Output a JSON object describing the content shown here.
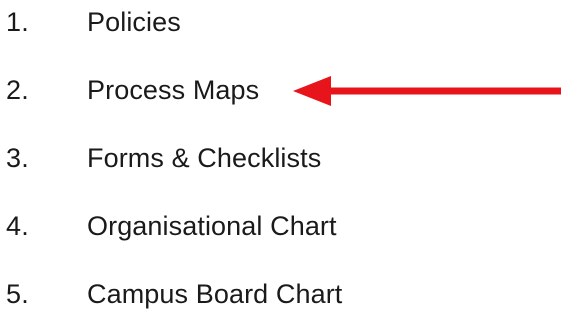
{
  "list": {
    "items": [
      {
        "number": "1.",
        "label": "Policies"
      },
      {
        "number": "2.",
        "label": "Process Maps"
      },
      {
        "number": "3.",
        "label": "Forms & Checklists"
      },
      {
        "number": "4.",
        "label": "Organisational Chart"
      },
      {
        "number": "5.",
        "label": "Campus Board Chart"
      }
    ]
  },
  "annotation": {
    "arrow_color": "#e8141b",
    "points_to": "2"
  }
}
